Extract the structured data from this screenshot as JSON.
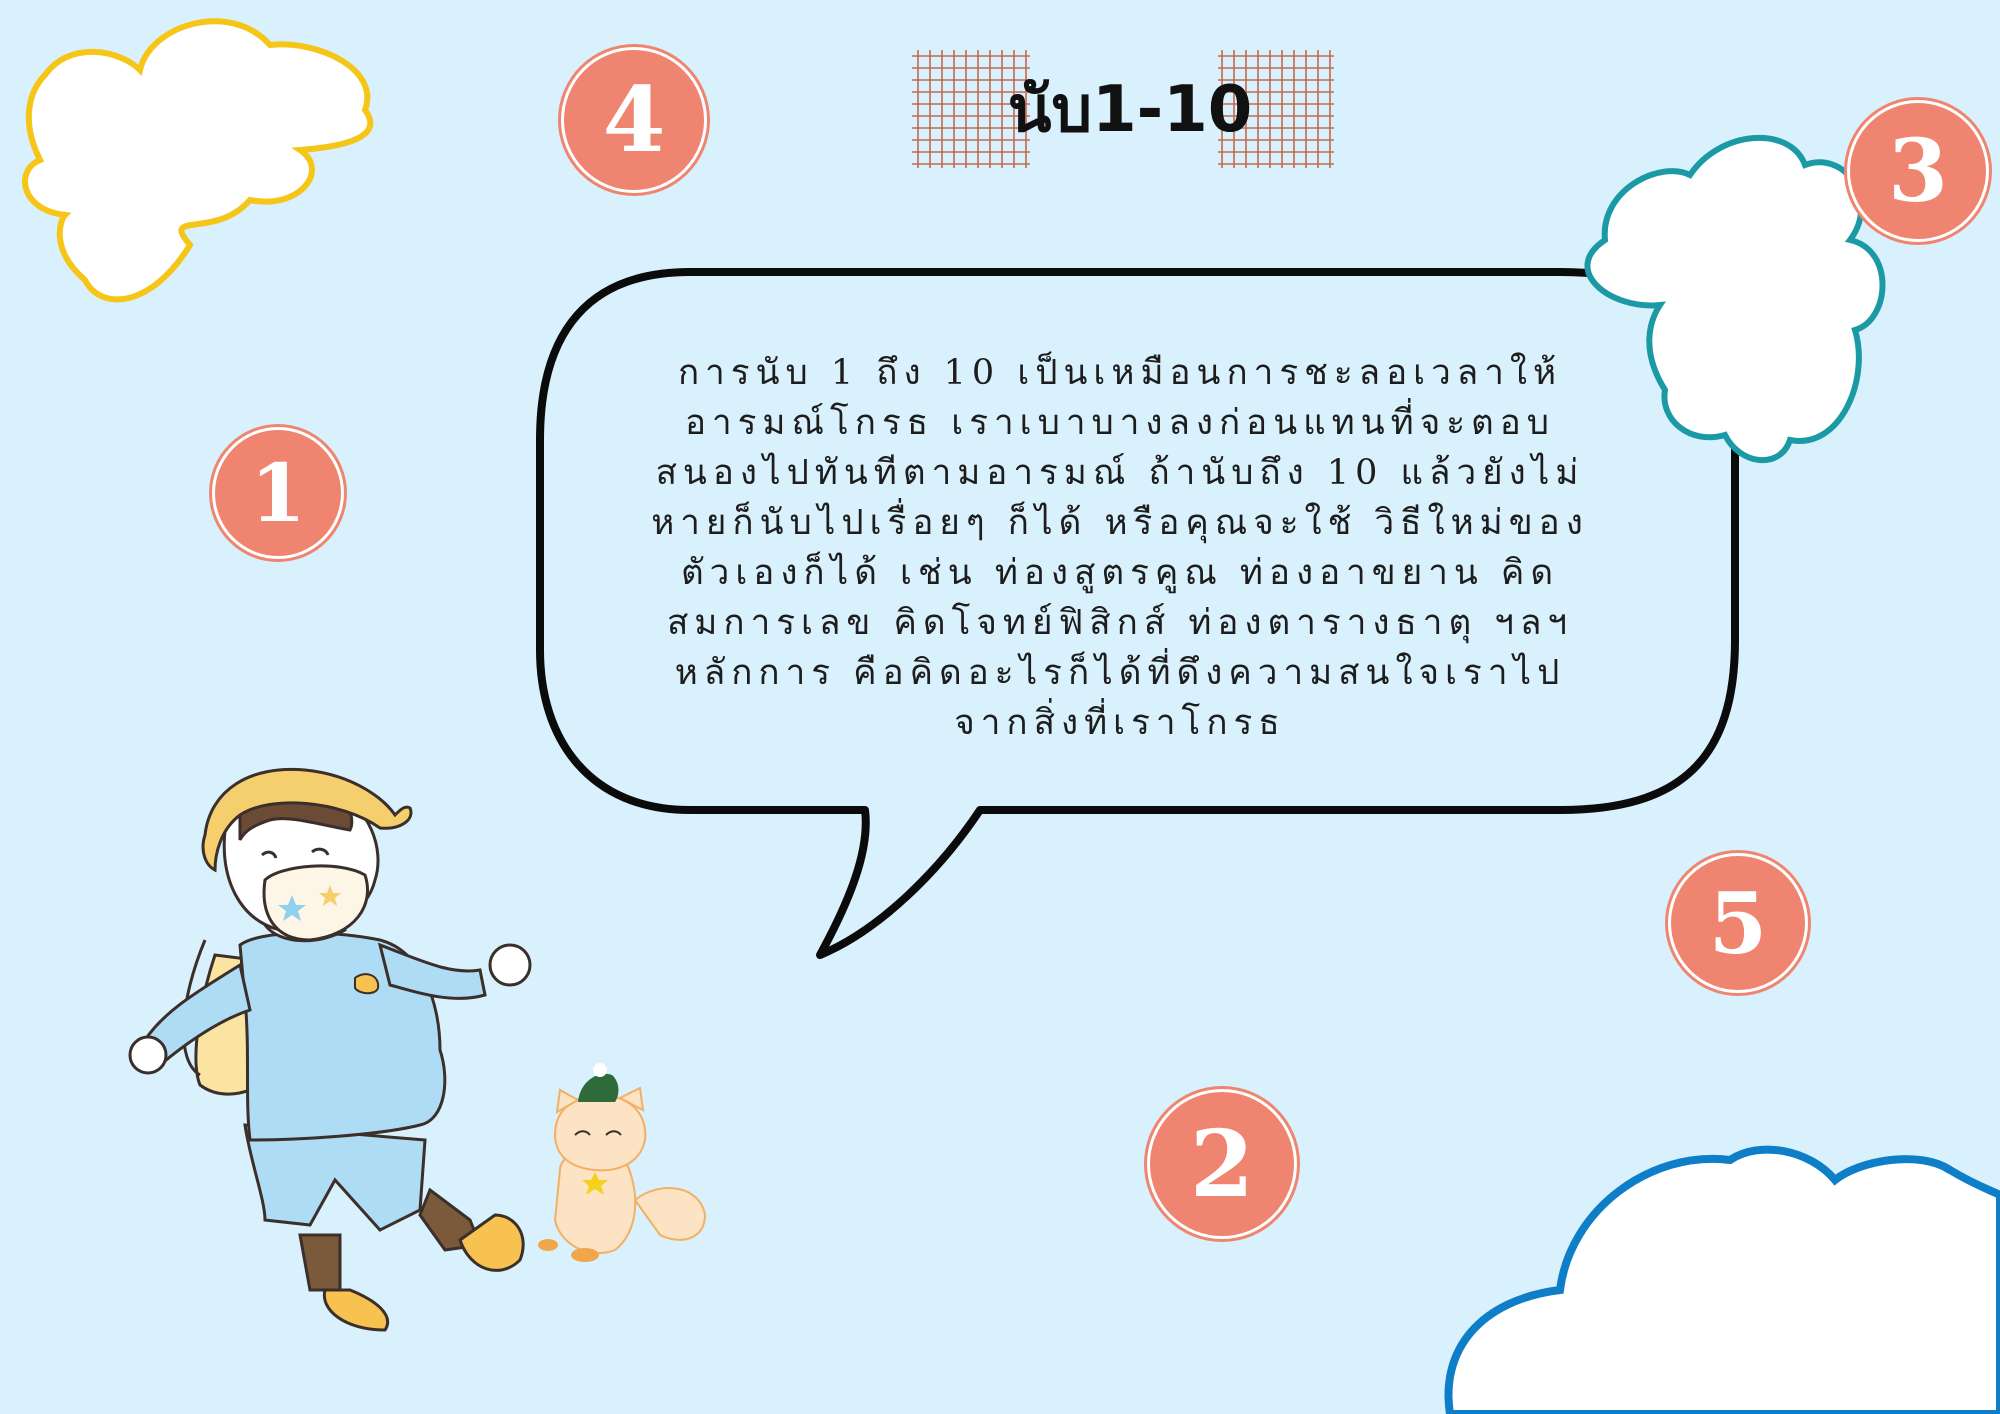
{
  "title": "นับ1-10",
  "message_lines": [
    "การนับ 1 ถึง 10 เป็นเหมือนการชะลอเวลาให้",
    "อารมณ์โกรธ เราเบาบางลงก่อนแทนที่จะตอบ",
    "สนองไปทันทีตามอารมณ์ ถ้านับถึง 10 แล้วยังไม่",
    "หายก็นับไปเรื่อยๆ ก็ได้ หรือคุณจะใช้ วิธีใหม่ของ",
    "ตัวเองก็ได้ เช่น ท่องสูตรคูณ ท่องอาขยาน คิด",
    "สมการเลข คิดโจทย์ฟิสิกส์ ท่องตารางธาตุ ฯลฯ",
    "หลักการ คือคิดอะไรก็ได้ที่ดึงความสนใจเราไป",
    "จากสิ่งที่เราโกรธ"
  ],
  "badges": [
    "1",
    "2",
    "3",
    "4",
    "5"
  ],
  "colors": {
    "background": "#d9f1fc",
    "badge": "#ef8570",
    "cloud_yellow": "#f5c518",
    "cloud_teal": "#1b9aa6",
    "cloud_blue": "#0f7ec8"
  }
}
